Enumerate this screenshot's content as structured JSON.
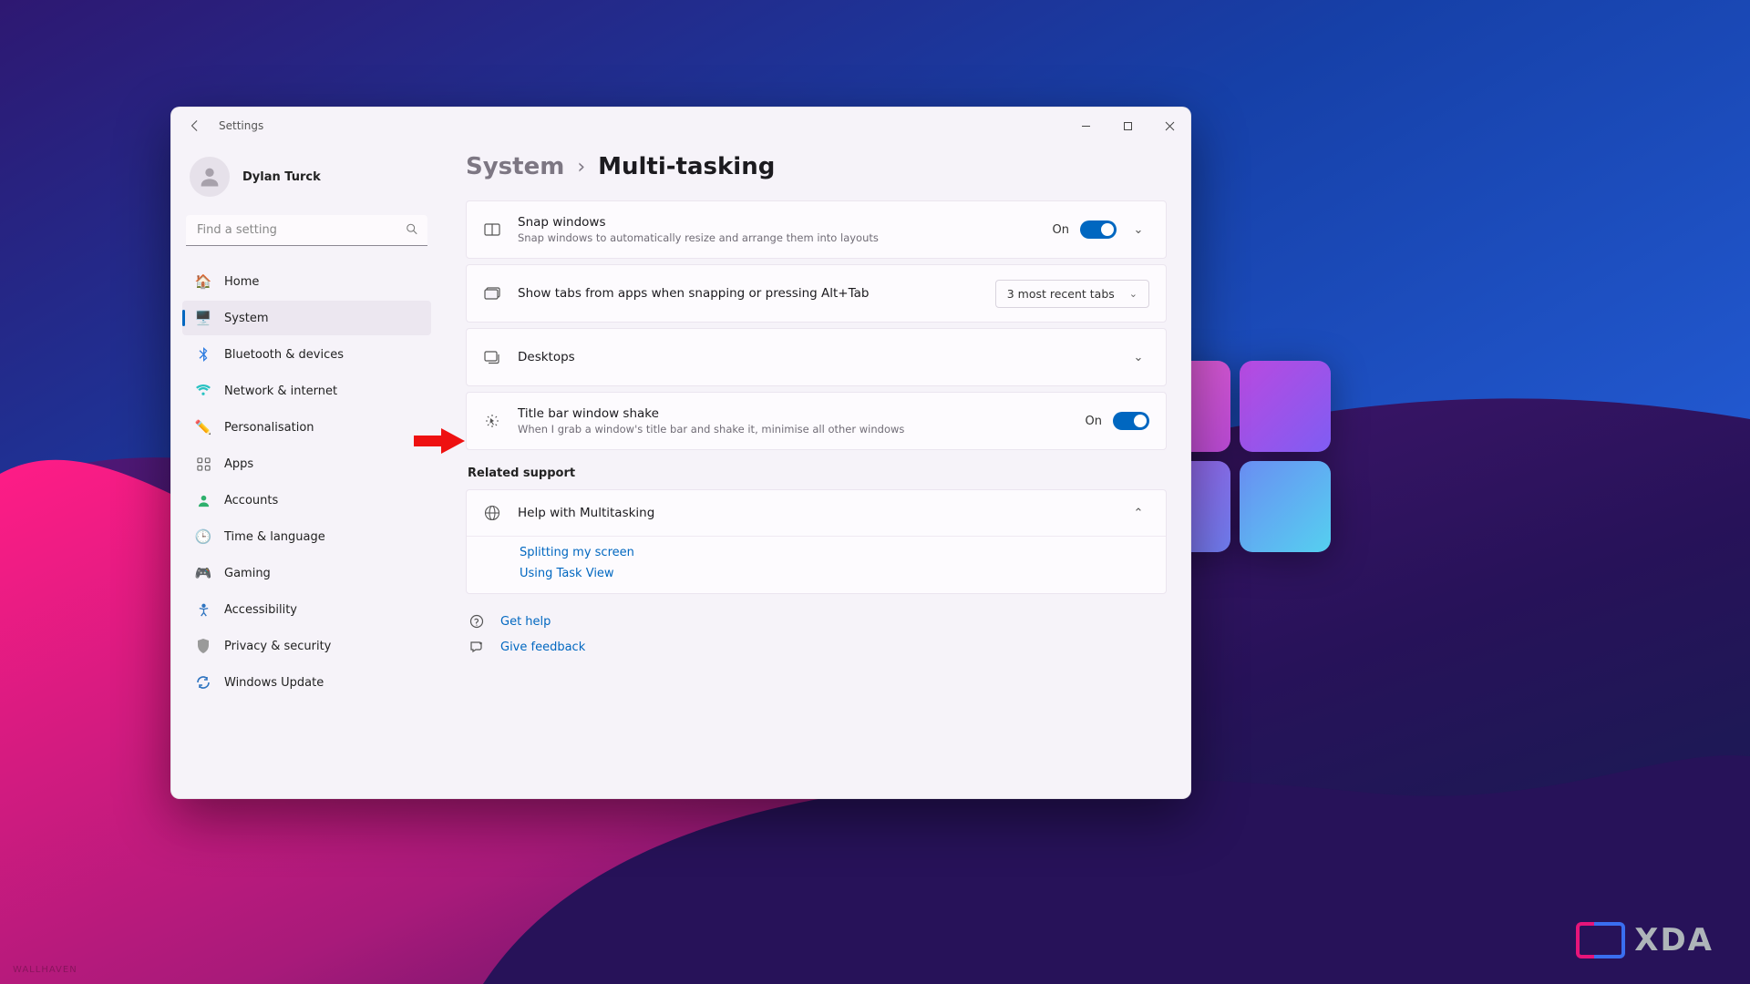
{
  "app": {
    "name": "Settings"
  },
  "profile": {
    "name": "Dylan Turck"
  },
  "search": {
    "placeholder": "Find a setting"
  },
  "sidebar": {
    "items": [
      {
        "label": "Home",
        "icon": "🏠",
        "color": "#e38b45"
      },
      {
        "label": "System",
        "icon": "💻",
        "color": "#3b82f6"
      },
      {
        "label": "Bluetooth & devices",
        "icon": "ᚼ",
        "color": "#2f7de1"
      },
      {
        "label": "Network & internet",
        "icon": "📶",
        "color": "#28c2c2"
      },
      {
        "label": "Personalisation",
        "icon": "🖌️",
        "color": "#d98a5e"
      },
      {
        "label": "Apps",
        "icon": "▦",
        "color": "#6b6b6b"
      },
      {
        "label": "Accounts",
        "icon": "👤",
        "color": "#2fb06d"
      },
      {
        "label": "Time & language",
        "icon": "🌐",
        "color": "#3b82c6"
      },
      {
        "label": "Gaming",
        "icon": "🎮",
        "color": "#8a8a8a"
      },
      {
        "label": "Accessibility",
        "icon": "⇑",
        "color": "#2f74c0"
      },
      {
        "label": "Privacy & security",
        "icon": "🛡️",
        "color": "#8a8a8a"
      },
      {
        "label": "Windows Update",
        "icon": "↻",
        "color": "#2f74c0"
      }
    ],
    "active_index": 1
  },
  "breadcrumb": {
    "parent": "System",
    "current": "Multi-tasking"
  },
  "settings": {
    "snap": {
      "title": "Snap windows",
      "sub": "Snap windows to automatically resize and arrange them into layouts",
      "state_label": "On"
    },
    "tabs": {
      "title": "Show tabs from apps when snapping or pressing Alt+Tab",
      "dropdown": "3 most recent tabs"
    },
    "desktops": {
      "title": "Desktops"
    },
    "shake": {
      "title": "Title bar window shake",
      "sub": "When I grab a window's title bar and shake it, minimise all other windows",
      "state_label": "On"
    }
  },
  "related_support": {
    "heading": "Related support",
    "help_title": "Help with Multitasking",
    "links": [
      "Splitting my screen",
      "Using Task View"
    ]
  },
  "footer_links": {
    "help": "Get help",
    "feedback": "Give feedback"
  },
  "watermarks": {
    "wallhaven": "WALLHAVEN",
    "xda": "XDA"
  }
}
